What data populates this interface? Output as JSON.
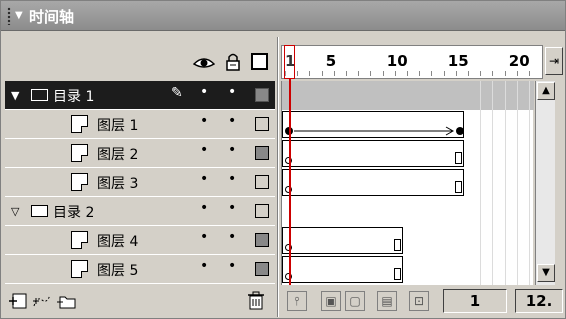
{
  "panel": {
    "title": "时间轴"
  },
  "header": {
    "eye_icon": "eye-icon",
    "lock_icon": "lock-icon",
    "outline_icon": "outline-icon"
  },
  "layers": [
    {
      "name": "目录 1",
      "type": "folder",
      "expanded": true,
      "selected": true,
      "indent": 0,
      "dot1": "•",
      "dot2": "•"
    },
    {
      "name": "图层 1",
      "type": "layer",
      "indent": 1,
      "dot1": "•",
      "dot2": "•"
    },
    {
      "name": "图层 2",
      "type": "layer",
      "indent": 1,
      "dot1": "•",
      "dot2": "•"
    },
    {
      "name": "图层 3",
      "type": "layer",
      "indent": 1,
      "dot1": "•",
      "dot2": "•"
    },
    {
      "name": "目录 2",
      "type": "folder",
      "expanded": true,
      "selected": false,
      "indent": 0,
      "dot1": "•",
      "dot2": "•"
    },
    {
      "name": "图层 4",
      "type": "layer",
      "indent": 1,
      "dot1": "•",
      "dot2": "•"
    },
    {
      "name": "图层 5",
      "type": "layer",
      "indent": 1,
      "dot1": "•",
      "dot2": "•"
    }
  ],
  "ruler": {
    "labels": [
      "1",
      "5",
      "10",
      "15",
      "20"
    ]
  },
  "frames": [
    {
      "tween": false,
      "end": 0
    },
    {
      "tween": true,
      "end": 15
    },
    {
      "tween": false,
      "end": 15
    },
    {
      "tween": false,
      "end": 15
    },
    {
      "tween": false,
      "end": 0
    },
    {
      "tween": false,
      "end": 10
    },
    {
      "tween": false,
      "end": 10
    }
  ],
  "status": {
    "current_frame": "1",
    "frame_rate": "12."
  },
  "colors": {
    "playhead": "#cc0000",
    "selected_row": "#1c1c1c"
  }
}
